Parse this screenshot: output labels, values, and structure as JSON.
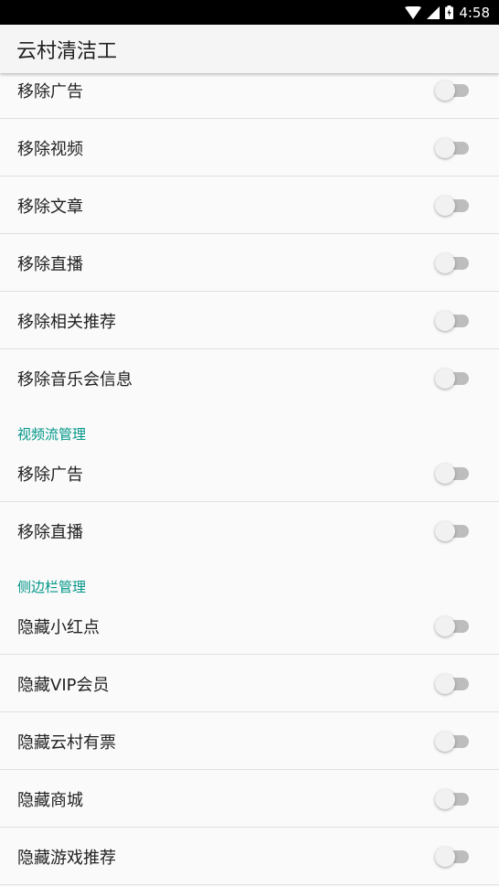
{
  "status_bar": {
    "time": "4:58"
  },
  "app_bar": {
    "title": "云村清洁工"
  },
  "rows": [
    {
      "label": "移除广告",
      "checked": false
    },
    {
      "label": "移除视频",
      "checked": false
    },
    {
      "label": "移除文章",
      "checked": false
    },
    {
      "label": "移除直播",
      "checked": false
    },
    {
      "label": "移除相关推荐",
      "checked": false
    },
    {
      "label": "移除音乐会信息",
      "checked": false
    }
  ],
  "categories": [
    {
      "title": "视频流管理",
      "rows": [
        {
          "label": "移除广告",
          "checked": false
        },
        {
          "label": "移除直播",
          "checked": false
        }
      ]
    },
    {
      "title": "侧边栏管理",
      "rows": [
        {
          "label": "隐藏小红点",
          "checked": false
        },
        {
          "label": "隐藏VIP会员",
          "checked": false
        },
        {
          "label": "隐藏云村有票",
          "checked": false
        },
        {
          "label": "隐藏商城",
          "checked": false
        },
        {
          "label": "隐藏游戏推荐",
          "checked": false
        }
      ]
    }
  ]
}
